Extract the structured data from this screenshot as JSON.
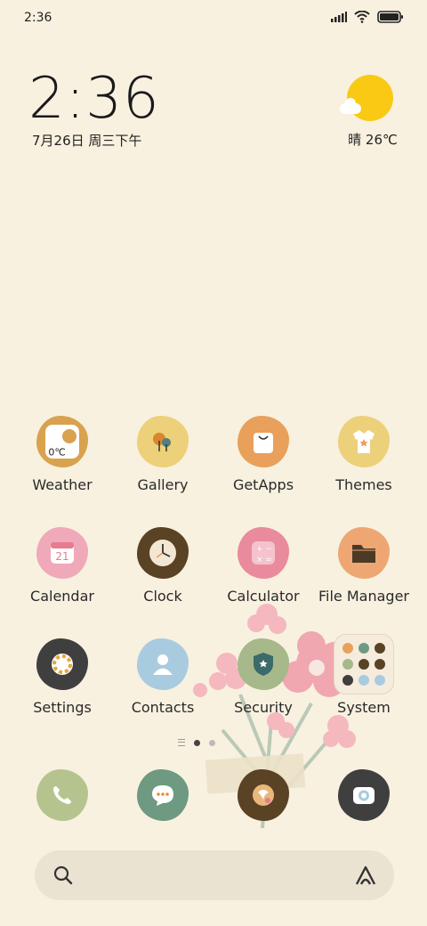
{
  "status_bar": {
    "time": "2:36"
  },
  "clock_widget": {
    "time": "2:36",
    "date": "7月26日 周三下午"
  },
  "weather_widget": {
    "text": "晴 26℃"
  },
  "apps": {
    "weather": {
      "label": "Weather",
      "badge": "0℃"
    },
    "gallery": {
      "label": "Gallery"
    },
    "getapps": {
      "label": "GetApps"
    },
    "themes": {
      "label": "Themes"
    },
    "calendar": {
      "label": "Calendar",
      "day": "21"
    },
    "clock": {
      "label": "Clock"
    },
    "calculator": {
      "label": "Calculator"
    },
    "file_manager": {
      "label": "File Manager"
    },
    "settings": {
      "label": "Settings"
    },
    "contacts": {
      "label": "Contacts"
    },
    "security": {
      "label": "Security"
    },
    "system": {
      "label": "System"
    }
  },
  "pager": {
    "pages": 2,
    "active_page": 1
  },
  "colors": {
    "background": "#f8f1e0",
    "weather": "#d9a24e",
    "gallery": "#ecd07a",
    "getapps": "#e9a05a",
    "themes": "#ecd07a",
    "calendar": "#f0a9b8",
    "clock": "#5a4224",
    "calculator": "#e98b9c",
    "file_manager": "#eea773",
    "settings": "#3f3f3f",
    "contacts": "#a9cbe0",
    "security": "#a7b88a",
    "phone": "#b5c48f",
    "messaging": "#6d9a80",
    "browser": "#5a4224",
    "camera": "#3f3f3f"
  }
}
